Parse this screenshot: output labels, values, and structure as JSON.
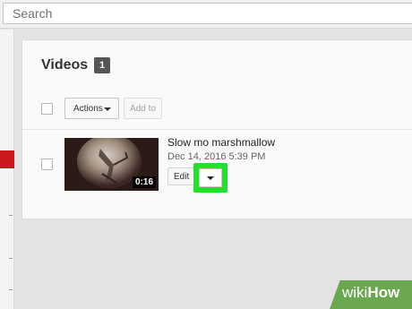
{
  "search": {
    "placeholder": "Search"
  },
  "videos_section": {
    "title": "Videos",
    "count": "1",
    "actions_label": "Actions",
    "add_to_label": "Add to"
  },
  "videos": [
    {
      "title": "Slow mo marshmallow",
      "date": "Dec 14, 2016 5:39 PM",
      "duration": "0:16",
      "edit_label": "Edit"
    }
  ],
  "highlight_color": "#23e02a",
  "watermark": {
    "wiki": "wiki",
    "how": "How"
  }
}
